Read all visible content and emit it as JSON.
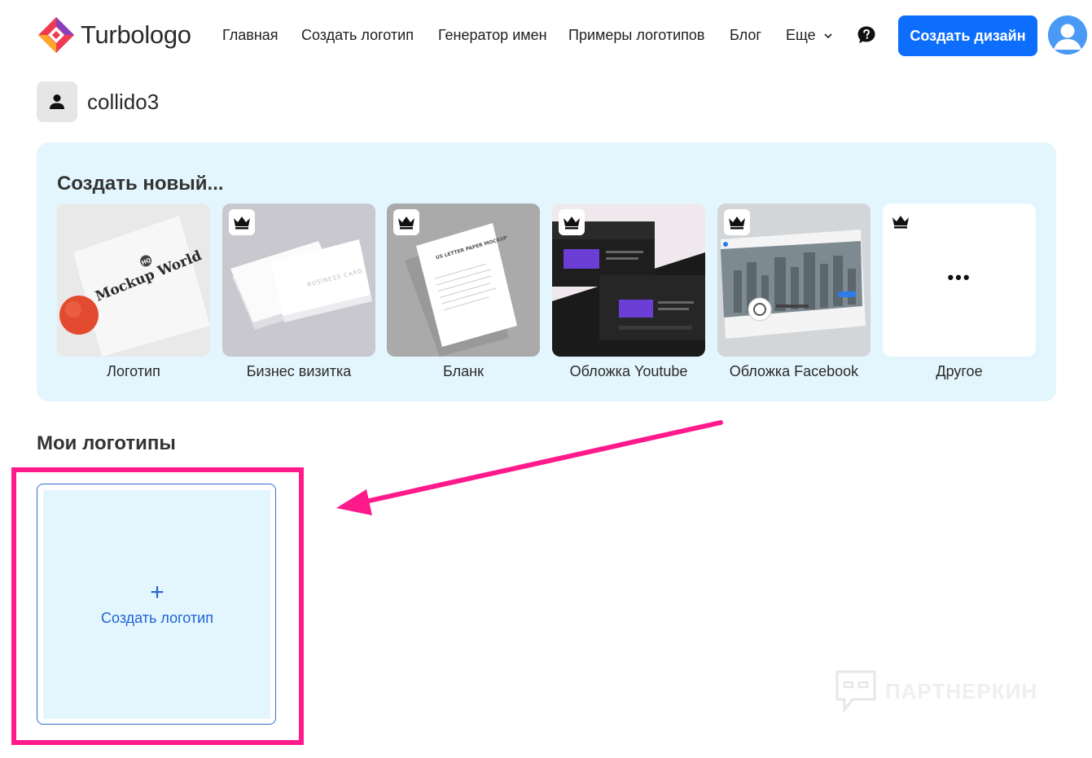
{
  "brand": {
    "name": "Turbologo",
    "accent": "#0d6efd",
    "highlight": "#ff1a8c"
  },
  "nav": {
    "items": [
      {
        "label": "Главная"
      },
      {
        "label": "Создать логотип"
      },
      {
        "label": "Генератор имен"
      },
      {
        "label": "Примеры логотипов"
      },
      {
        "label": "Блог"
      },
      {
        "label": "Еще"
      }
    ],
    "help_icon": "question-bubble-icon",
    "cta_label": "Создать дизайн",
    "avatar_icon": "user-avatar-icon"
  },
  "user": {
    "name": "collido3",
    "icon": "person-icon"
  },
  "create_new": {
    "title": "Создать новый...",
    "cards": [
      {
        "label": "Логотип",
        "premium": false,
        "mockup_text": "Mockup World",
        "mockup_badge": "HQ"
      },
      {
        "label": "Бизнес визитка",
        "premium": true,
        "mockup_text": "BUSINESS CARD"
      },
      {
        "label": "Бланк",
        "premium": true,
        "mockup_text": "US LETTER PAPER MOCKUP"
      },
      {
        "label": "Обложка Youtube",
        "premium": true
      },
      {
        "label": "Обложка Facebook",
        "premium": true
      },
      {
        "label": "Другое",
        "premium": true,
        "glyph": "•••"
      }
    ]
  },
  "my_logos": {
    "title": "Мои логотипы",
    "create_plus": "+",
    "create_label": "Создать логотип"
  },
  "watermark": {
    "text": "ПАРТНЕРКИН"
  }
}
